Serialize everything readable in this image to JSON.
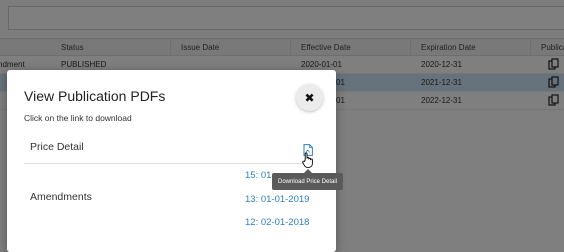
{
  "table": {
    "columns": [
      "Status",
      "Issue Date",
      "Effective Date",
      "Expiration Date",
      "Publica"
    ],
    "rows": [
      {
        "type": "ndment",
        "status": "PUBLISHED",
        "issue_date": "",
        "effective_date": "2020-01-01",
        "expiration_date": "2020-12-31",
        "publication_icon": "copy-icon",
        "selected": false
      },
      {
        "type": "",
        "status": "",
        "issue_date": "",
        "effective_date": "01",
        "expiration_date": "2021-12-31",
        "publication_icon": "copy-icon",
        "selected": true
      },
      {
        "type": "",
        "status": "",
        "issue_date": "",
        "effective_date": "01",
        "expiration_date": "2022-12-31",
        "publication_icon": "copy-icon",
        "selected": false
      }
    ]
  },
  "modal": {
    "title": "View Publication PDFs",
    "subtitle": "Click on the link to download",
    "close_glyph": "✖",
    "price_detail": {
      "label": "Price Detail",
      "icon": "pdf-file-icon",
      "tooltip": "Download Price Detail"
    },
    "amendments": {
      "label": "Amendments",
      "links": [
        "15: 01",
        "13: 01-01-2019",
        "12: 02-01-2018"
      ]
    }
  },
  "colors": {
    "link": "#2f7ec4",
    "selected_row": "#cfe6f8",
    "tooltip_bg": "#5a5a5a"
  }
}
